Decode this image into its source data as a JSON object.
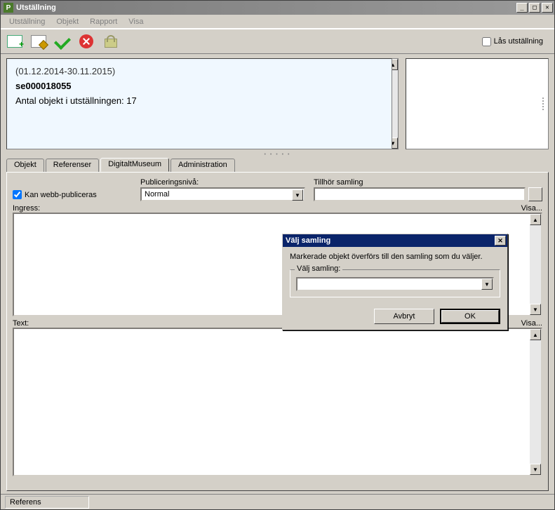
{
  "window": {
    "title": "Utställning"
  },
  "menu": {
    "items": [
      "Utställning",
      "Objekt",
      "Rapport",
      "Visa"
    ]
  },
  "toolbar": {
    "lock_label": "Lås utställning"
  },
  "info": {
    "date_range": "(01.12.2014-30.11.2015)",
    "id": "se000018055",
    "count_text": "Antal objekt i utställningen: 17"
  },
  "tabs": {
    "items": [
      "Objekt",
      "Referenser",
      "DigitaltMuseum",
      "Administration"
    ],
    "active": "DigitaltMuseum"
  },
  "dm": {
    "webpub_label": "Kan webb-publiceras",
    "pubniva_label": "Publiceringsnivå:",
    "pubniva_value": "Normal",
    "samling_label": "Tillhör samling",
    "ingress_label": "Ingress:",
    "text_label": "Text:",
    "visa_label": "Visa..."
  },
  "modal": {
    "title": "Välj samling",
    "message": "Markerade objekt överförs till den samling som du väljer.",
    "group_label": "Välj samling:",
    "cancel": "Avbryt",
    "ok": "OK"
  },
  "status": {
    "referens": "Referens"
  }
}
